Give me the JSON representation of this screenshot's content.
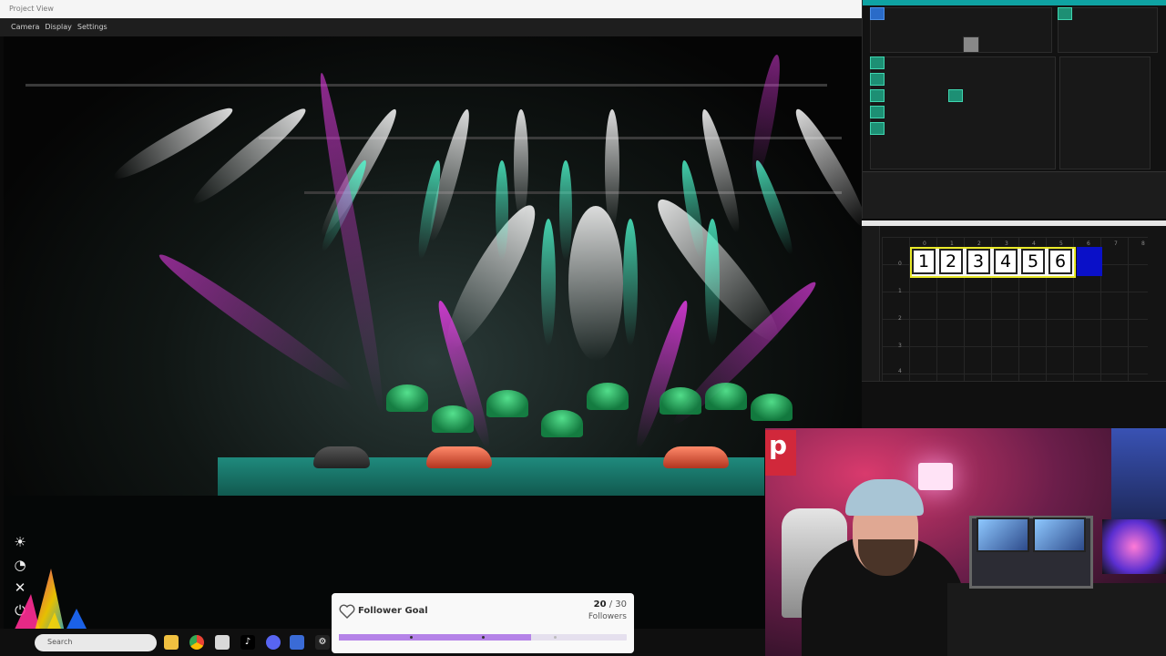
{
  "project_view": {
    "title": "Project View",
    "menu": [
      "Camera",
      "Display",
      "Settings"
    ]
  },
  "side_toolbar": {
    "icons": [
      "brightness-icon",
      "gauge-icon",
      "tools-icon",
      "power-icon"
    ]
  },
  "taskbar": {
    "search_placeholder": "Search",
    "apps": [
      "file-explorer-icon",
      "chrome-icon",
      "mail-icon",
      "tiktok-icon",
      "discord-icon",
      "app-icon",
      "settings-icon"
    ]
  },
  "follower_goal": {
    "title": "Follower Goal",
    "current": "20",
    "separator": " / ",
    "target": "30",
    "unit": "Followers",
    "progress_fraction": 0.6667,
    "accent": "#b583e8"
  },
  "executor_window": {
    "column_numbers": [
      "0",
      "1",
      "2",
      "3",
      "4",
      "5",
      "6",
      "7",
      "8"
    ],
    "row_numbers": [
      "0",
      "1",
      "2",
      "3",
      "4"
    ],
    "exec_boxes": [
      "1",
      "2",
      "3",
      "4",
      "5",
      "6"
    ],
    "highlight_color": "#0a10c8"
  },
  "webcam": {
    "sign_letter": "p"
  }
}
